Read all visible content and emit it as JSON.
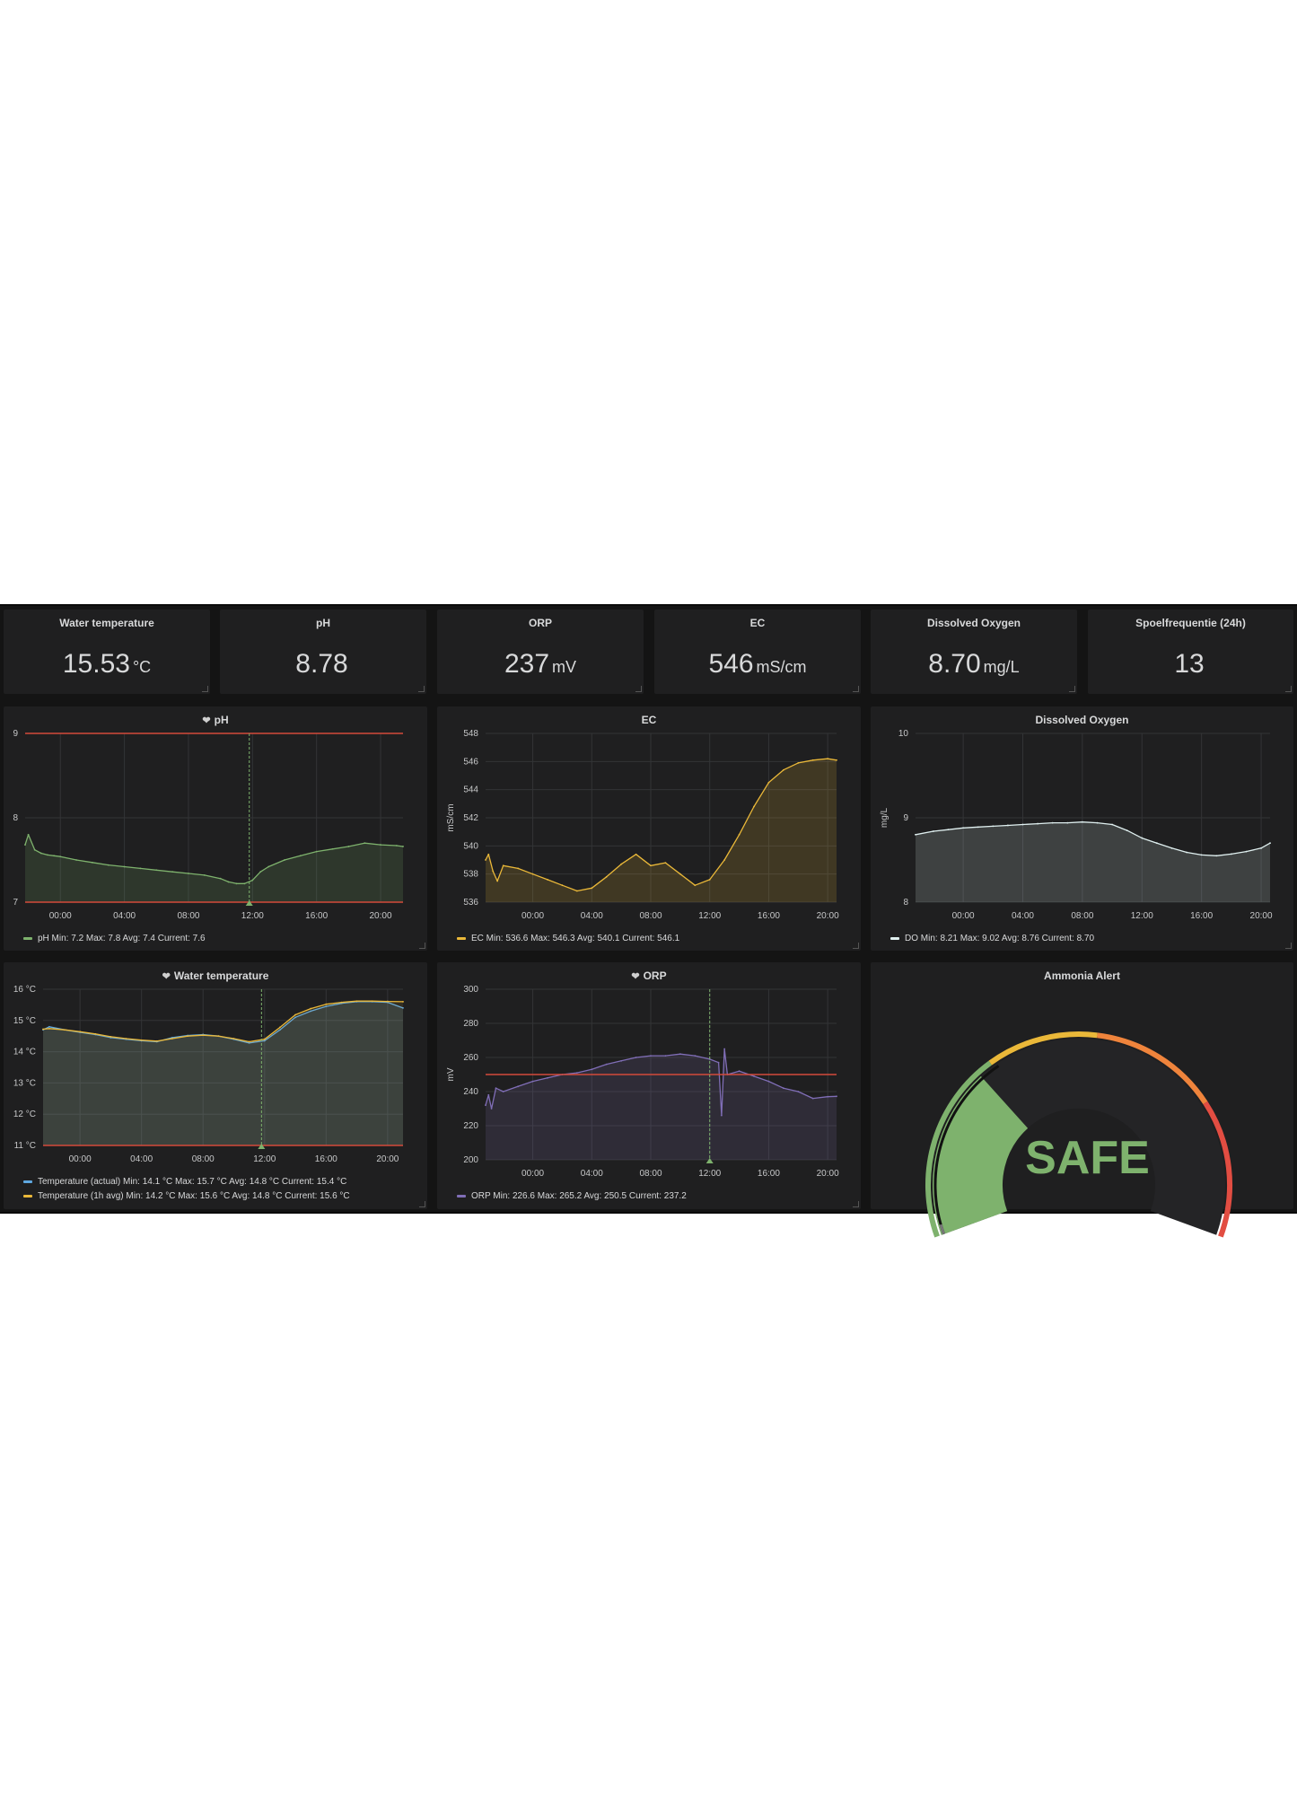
{
  "stats": [
    {
      "title": "Water temperature",
      "value": "15.53",
      "unit": "°C"
    },
    {
      "title": "pH",
      "value": "8.78",
      "unit": ""
    },
    {
      "title": "ORP",
      "value": "237",
      "unit": "mV"
    },
    {
      "title": "EC",
      "value": "546",
      "unit": "mS/cm"
    },
    {
      "title": "Dissolved Oxygen",
      "value": "8.70",
      "unit": "mg/L"
    },
    {
      "title": "Spoelfrequentie (24h)",
      "value": "13",
      "unit": ""
    }
  ],
  "graphs": {
    "ph": {
      "title": "pH",
      "heart": true,
      "legend": [
        {
          "color": "#7eb26d",
          "text": "pH  Min: 7.2  Max: 7.8  Avg: 7.4  Current: 7.6"
        }
      ]
    },
    "ec": {
      "title": "EC",
      "heart": false,
      "legend": [
        {
          "color": "#eab839",
          "text": "EC  Min: 536.6  Max: 546.3  Avg: 540.1  Current: 546.1"
        }
      ]
    },
    "do": {
      "title": "Dissolved Oxygen",
      "heart": false,
      "legend": [
        {
          "color": "#e0f0f0",
          "text": "DO  Min: 8.21  Max: 9.02  Avg: 8.76  Current: 8.70"
        }
      ]
    },
    "temp": {
      "title": "Water temperature",
      "heart": true,
      "legend": [
        {
          "color": "#5fa8e0",
          "text": "Temperature (actual)  Min: 14.1 °C  Max: 15.7 °C  Avg: 14.8 °C  Current: 15.4 °C"
        },
        {
          "color": "#eab839",
          "text": "Temperature (1h avg)  Min: 14.2 °C  Max: 15.6 °C  Avg: 14.8 °C  Current: 15.6 °C"
        }
      ]
    },
    "orp": {
      "title": "ORP",
      "heart": true,
      "legend": [
        {
          "color": "#806eb7",
          "text": "ORP  Min: 226.6  Max: 265.2  Avg: 250.5  Current: 237.2"
        }
      ]
    }
  },
  "ammonia": {
    "title": "Ammonia Alert",
    "status": "SAFE",
    "status_color": "#7eb26d"
  },
  "chart_data": [
    {
      "id": "ph",
      "type": "line",
      "title": "pH",
      "x_ticks": [
        "00:00",
        "04:00",
        "08:00",
        "12:00",
        "16:00",
        "20:00"
      ],
      "y_ticks": [
        "7",
        "8",
        "9"
      ],
      "ylim": [
        7,
        9
      ],
      "xlim": [
        -2.2,
        21.4
      ],
      "thresholds": [
        7,
        9
      ],
      "annotation_x": 11.8,
      "grid": true,
      "legend": "bottom",
      "series": [
        {
          "name": "pH",
          "color": "#7eb26d",
          "x": [
            -2.2,
            -2.0,
            -1.6,
            -1.2,
            -0.8,
            -0.4,
            0,
            1,
            2,
            3,
            4,
            5,
            6,
            7,
            8,
            9,
            10,
            10.5,
            11,
            11.5,
            12,
            12.5,
            13,
            14,
            15,
            16,
            17,
            18,
            19,
            20,
            21,
            21.4
          ],
          "y": [
            7.68,
            7.8,
            7.62,
            7.58,
            7.56,
            7.55,
            7.54,
            7.5,
            7.47,
            7.44,
            7.42,
            7.4,
            7.38,
            7.36,
            7.34,
            7.32,
            7.28,
            7.24,
            7.22,
            7.22,
            7.26,
            7.36,
            7.42,
            7.5,
            7.55,
            7.6,
            7.63,
            7.66,
            7.7,
            7.68,
            7.67,
            7.66
          ]
        }
      ]
    },
    {
      "id": "ec",
      "type": "line",
      "title": "EC",
      "ylabel": "mS/cm",
      "x_ticks": [
        "00:00",
        "04:00",
        "08:00",
        "12:00",
        "16:00",
        "20:00"
      ],
      "y_ticks": [
        "536",
        "538",
        "540",
        "542",
        "544",
        "546",
        "548"
      ],
      "ylim": [
        536,
        548
      ],
      "xlim": [
        -3.2,
        20.6
      ],
      "grid": true,
      "legend": "bottom",
      "series": [
        {
          "name": "EC",
          "color": "#eab839",
          "x": [
            -3.2,
            -3.0,
            -2.7,
            -2.4,
            -2.0,
            -1.0,
            0,
            1,
            2,
            3,
            4,
            5,
            6,
            7,
            8,
            9,
            10,
            11,
            12,
            13,
            14,
            15,
            16,
            17,
            18,
            19,
            20,
            20.6
          ],
          "y": [
            539.0,
            539.4,
            538.2,
            537.5,
            538.6,
            538.4,
            538.0,
            537.6,
            537.2,
            536.8,
            537.0,
            537.8,
            538.7,
            539.4,
            538.6,
            538.8,
            538.0,
            537.2,
            537.6,
            539.0,
            540.8,
            542.8,
            544.5,
            545.4,
            545.9,
            546.1,
            546.2,
            546.1
          ]
        }
      ]
    },
    {
      "id": "do",
      "type": "line",
      "title": "Dissolved Oxygen",
      "ylabel": "mg/L",
      "x_ticks": [
        "00:00",
        "04:00",
        "08:00",
        "12:00",
        "16:00",
        "20:00"
      ],
      "y_ticks": [
        "8",
        "9",
        "10"
      ],
      "ylim": [
        8,
        10
      ],
      "xlim": [
        -3.2,
        20.6
      ],
      "grid": true,
      "legend": "bottom",
      "series": [
        {
          "name": "DO",
          "color": "#e0f0f0",
          "x": [
            -3.2,
            -2,
            -1,
            0,
            1,
            2,
            3,
            4,
            5,
            6,
            7,
            8,
            9,
            10,
            11,
            12,
            13,
            14,
            15,
            16,
            17,
            18,
            19,
            20,
            20.6
          ],
          "y": [
            8.8,
            8.84,
            8.86,
            8.88,
            8.89,
            8.9,
            8.91,
            8.92,
            8.93,
            8.94,
            8.94,
            8.95,
            8.94,
            8.92,
            8.85,
            8.76,
            8.7,
            8.64,
            8.59,
            8.56,
            8.55,
            8.57,
            8.6,
            8.64,
            8.7
          ]
        }
      ]
    },
    {
      "id": "temp",
      "type": "line",
      "title": "Water temperature",
      "x_ticks": [
        "00:00",
        "04:00",
        "08:00",
        "12:00",
        "16:00",
        "20:00"
      ],
      "y_ticks": [
        "11 °C",
        "12 °C",
        "13 °C",
        "14 °C",
        "15 °C",
        "16 °C"
      ],
      "ylim": [
        11,
        16
      ],
      "xlim": [
        -2.4,
        21.0
      ],
      "thresholds": [
        11
      ],
      "annotation_x": 11.8,
      "grid": true,
      "legend": "bottom",
      "series": [
        {
          "name": "Temperature (actual)",
          "color": "#5fa8e0",
          "x": [
            -2.4,
            -2,
            -1,
            0,
            1,
            2,
            3,
            4,
            5,
            6,
            7,
            8,
            9,
            10,
            11,
            12,
            13,
            14,
            15,
            16,
            17,
            18,
            19,
            20,
            21
          ],
          "y": [
            14.7,
            14.8,
            14.7,
            14.62,
            14.55,
            14.45,
            14.4,
            14.35,
            14.32,
            14.45,
            14.52,
            14.55,
            14.5,
            14.4,
            14.28,
            14.35,
            14.7,
            15.1,
            15.3,
            15.45,
            15.55,
            15.6,
            15.6,
            15.58,
            15.4
          ]
        },
        {
          "name": "Temperature (1h avg)",
          "color": "#eab839",
          "x": [
            -2.4,
            -2,
            -1,
            0,
            1,
            2,
            3,
            4,
            5,
            6,
            7,
            8,
            9,
            10,
            11,
            12,
            13,
            14,
            15,
            16,
            17,
            18,
            19,
            20,
            21
          ],
          "y": [
            14.72,
            14.74,
            14.7,
            14.64,
            14.57,
            14.48,
            14.42,
            14.37,
            14.34,
            14.42,
            14.5,
            14.53,
            14.5,
            14.42,
            14.32,
            14.4,
            14.78,
            15.18,
            15.38,
            15.52,
            15.58,
            15.62,
            15.62,
            15.61,
            15.6
          ]
        }
      ]
    },
    {
      "id": "orp",
      "type": "line",
      "title": "ORP",
      "ylabel": "mV",
      "x_ticks": [
        "00:00",
        "04:00",
        "08:00",
        "12:00",
        "16:00",
        "20:00"
      ],
      "y_ticks": [
        "200",
        "220",
        "240",
        "260",
        "280",
        "300"
      ],
      "ylim": [
        200,
        300
      ],
      "xlim": [
        -3.2,
        20.6
      ],
      "thresholds": [
        250
      ],
      "annotation_x": 12.0,
      "grid": true,
      "legend": "bottom",
      "series": [
        {
          "name": "ORP",
          "color": "#806eb7",
          "x": [
            -3.2,
            -3.0,
            -2.8,
            -2.5,
            -2,
            -1,
            0,
            1,
            2,
            3,
            4,
            5,
            6,
            7,
            8,
            9,
            10,
            11,
            12,
            12.6,
            12.8,
            13.0,
            13.2,
            14,
            15,
            16,
            17,
            18,
            19,
            20,
            20.6
          ],
          "y": [
            232,
            238,
            230,
            242,
            240,
            243,
            246,
            248,
            250,
            251,
            253,
            256,
            258,
            260,
            261,
            261,
            262,
            261,
            259,
            257,
            226,
            265,
            250,
            252,
            249,
            246,
            242,
            240,
            236,
            237,
            237.2
          ]
        }
      ]
    },
    {
      "id": "ammonia",
      "type": "gauge",
      "title": "Ammonia Alert",
      "value_text": "SAFE",
      "bands": [
        {
          "color": "#7eb26d"
        },
        {
          "color": "#eab839"
        },
        {
          "color": "#ef843c"
        },
        {
          "color": "#e24d42"
        }
      ]
    }
  ]
}
